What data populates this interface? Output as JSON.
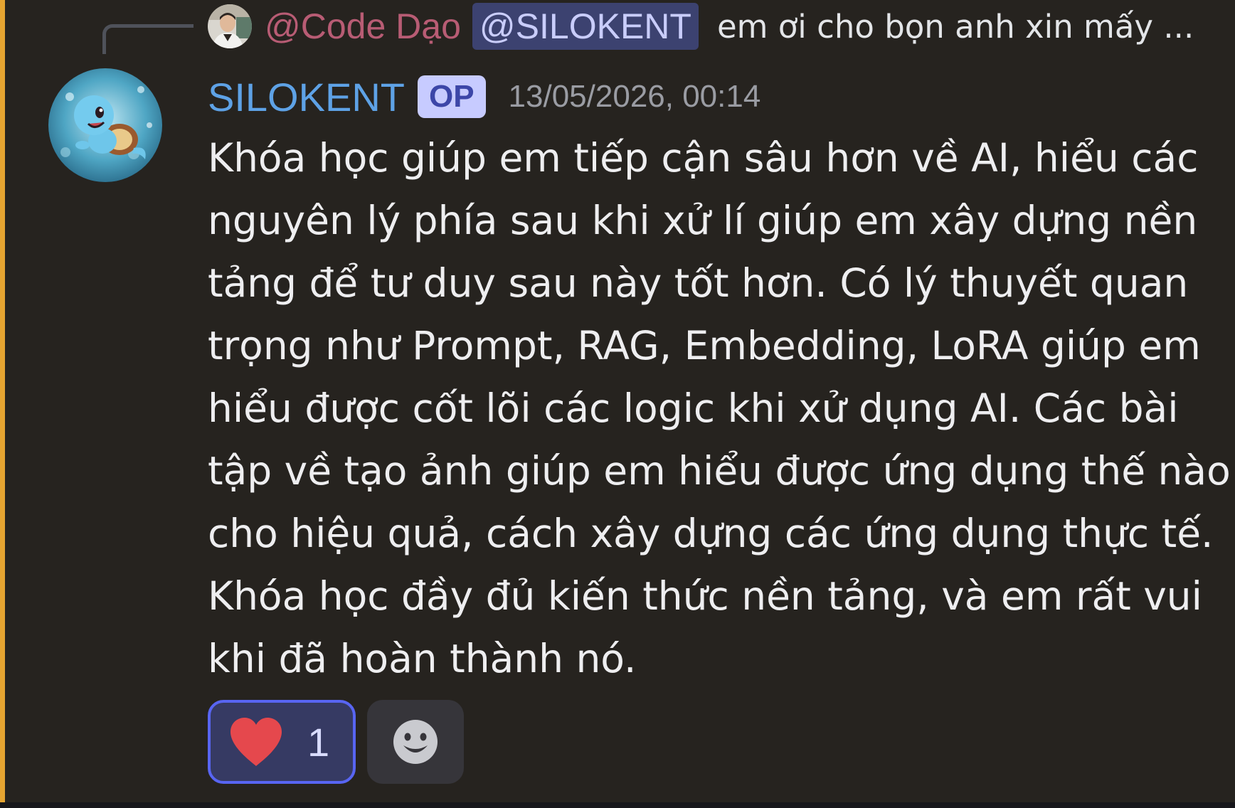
{
  "reply": {
    "author": "@Code Dạo",
    "mention": "@SILOKENT",
    "preview": "em ơi cho bọn anh xin mấy ...",
    "avatar_icon": "user-photo-avatar"
  },
  "message": {
    "author": "SILOKENT",
    "badge": "OP",
    "timestamp": "13/05/2026, 00:14",
    "avatar_icon": "squirtle-avatar",
    "lines": [
      "Khóa học giúp em tiếp cận sâu hơn về AI, hiểu các",
      "nguyên lý phía sau khi xử lí giúp em xây dựng nền",
      "tảng để tư duy sau này tốt hơn. Có lý thuyết quan",
      "trọng như Prompt, RAG, Embedding, LoRA giúp em",
      "hiểu được cốt lõi các logic khi xử dụng AI. Các bài",
      "tập về tạo ảnh giúp em hiểu được ứng dụng thế nào",
      "cho hiệu quả, cách xây dựng các ứng dụng thực tế.",
      "Khóa học đầy đủ kiến thức nền tảng, và em rất vui",
      "khi đã hoàn thành nó."
    ]
  },
  "reactions": [
    {
      "emoji": "heart-icon",
      "count": "1",
      "active": true
    }
  ],
  "add_reaction_icon": "smiley-icon",
  "colors": {
    "background": "#26231f",
    "accent_bar": "#e5a431",
    "username": "#5ea2e6",
    "reply_author": "#b85c74",
    "mention_bg": "#3c4270",
    "op_badge_bg": "#c7cbff",
    "reaction_border": "#5865f2",
    "heart": "#e5484d"
  }
}
